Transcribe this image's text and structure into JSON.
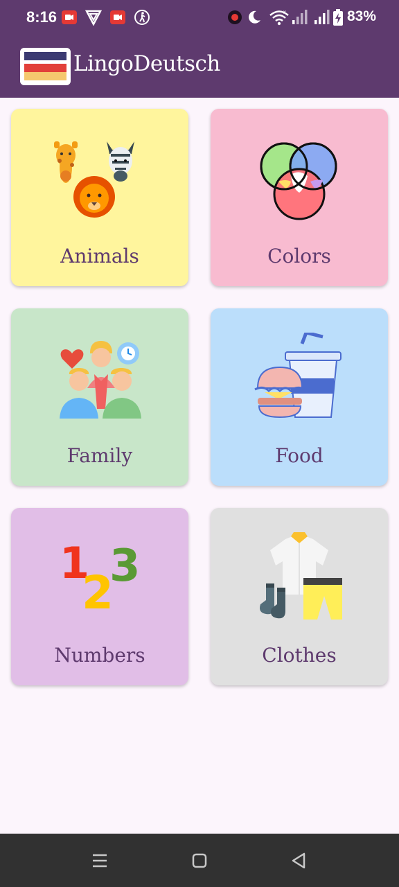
{
  "status_bar": {
    "time": "8:16",
    "battery": "83%",
    "icons": [
      "screen-record-icon",
      "vpn-icon",
      "screen-record-icon",
      "accessibility-icon",
      "record-dot-icon",
      "moon-icon",
      "wifi-icon",
      "signal-icon",
      "signal-icon",
      "battery-icon"
    ]
  },
  "app_bar": {
    "title": "LingoDeutsch",
    "flag_colors": [
      "#3c3b72",
      "#e2403a",
      "#f5c86e"
    ]
  },
  "categories": [
    {
      "label": "Animals",
      "bg": "#fff59d",
      "icon": "animals-icon"
    },
    {
      "label": "Colors",
      "bg": "#f8bbd0",
      "icon": "colors-icon"
    },
    {
      "label": "Family",
      "bg": "#c8e6c9",
      "icon": "family-icon"
    },
    {
      "label": "Food",
      "bg": "#bbdefb",
      "icon": "food-icon"
    },
    {
      "label": "Numbers",
      "bg": "#e1bee7",
      "icon": "numbers-icon"
    },
    {
      "label": "Clothes",
      "bg": "#e0e0e0",
      "icon": "clothes-icon"
    }
  ],
  "nav_bar": {
    "buttons": [
      "menu-icon",
      "home-icon",
      "back-icon"
    ]
  }
}
